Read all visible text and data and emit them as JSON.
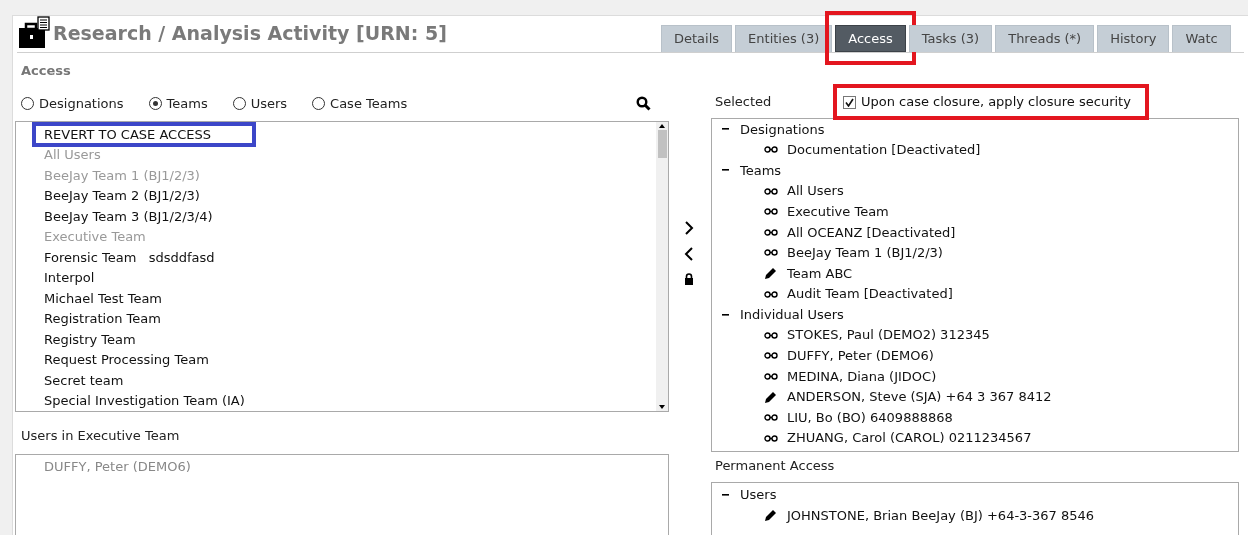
{
  "window": {
    "title": "Research / Analysis Activity [URN: 5]"
  },
  "tabs": [
    {
      "label": "Details",
      "selected": false
    },
    {
      "label": "Entities (3)",
      "selected": false
    },
    {
      "label": "Access",
      "selected": true,
      "color": "#e3161f"
    },
    {
      "label": "Tasks (3)",
      "selected": false
    },
    {
      "label": "Threads (*)",
      "selected": false
    },
    {
      "label": "History",
      "selected": false
    },
    {
      "label": "Watc",
      "selected": false
    }
  ],
  "section_label": "Access",
  "radios": [
    {
      "label": "Designations",
      "selected": false
    },
    {
      "label": "Teams",
      "selected": true
    },
    {
      "label": "Users",
      "selected": false
    },
    {
      "label": "Case Teams",
      "selected": false
    }
  ],
  "team_list": [
    {
      "label": "REVERT TO CASE ACCESS",
      "disabled": false,
      "color": "#3c46c8"
    },
    {
      "label": "All Users",
      "disabled": true
    },
    {
      "label": "BeeJay Team 1 (BJ1/2/3)",
      "disabled": true
    },
    {
      "label": "BeeJay Team 2 (BJ1/2/3)",
      "disabled": false
    },
    {
      "label": "BeeJay Team 3 (BJ1/2/3/4)",
      "disabled": false
    },
    {
      "label": "Executive Team",
      "disabled": true
    },
    {
      "label": "Forensic Team   sdsddfasd",
      "disabled": false
    },
    {
      "label": "Interpol",
      "disabled": false
    },
    {
      "label": "Michael Test Team",
      "disabled": false
    },
    {
      "label": "Registration Team",
      "disabled": false
    },
    {
      "label": "Registry Team",
      "disabled": false
    },
    {
      "label": "Request Processing Team",
      "disabled": false
    },
    {
      "label": "Secret team",
      "disabled": false
    },
    {
      "label": "Special Investigation Team (IA)",
      "disabled": false
    }
  ],
  "users_label": "Users in Executive Team",
  "users_list": [
    "DUFFY, Peter (DEMO6)"
  ],
  "selected_label": "Selected",
  "closure_checkbox": {
    "label": "Upon case closure, apply closure security",
    "checked": true,
    "color": "#e3161f"
  },
  "selected_tree": [
    {
      "label": "Designations",
      "expanded": true,
      "children": [
        {
          "label": "Documentation [Deactivated]",
          "kind": "view"
        }
      ]
    },
    {
      "label": "Teams",
      "expanded": true,
      "children": [
        {
          "label": "All Users",
          "kind": "view"
        },
        {
          "label": "Executive Team",
          "kind": "view"
        },
        {
          "label": "All OCEANZ [Deactivated]",
          "kind": "view"
        },
        {
          "label": "BeeJay Team 1 (BJ1/2/3)",
          "kind": "view"
        },
        {
          "label": "Team ABC",
          "kind": "edit"
        },
        {
          "label": "Audit Team [Deactivated]",
          "kind": "view"
        }
      ]
    },
    {
      "label": "Individual Users",
      "expanded": true,
      "children": [
        {
          "label": "STOKES, Paul (DEMO2) 312345",
          "kind": "view"
        },
        {
          "label": "DUFFY, Peter (DEMO6)",
          "kind": "view"
        },
        {
          "label": "MEDINA, Diana (JIDOC)",
          "kind": "view"
        },
        {
          "label": "ANDERSON, Steve (SJA) +64 3 367 8412",
          "kind": "edit"
        },
        {
          "label": "LIU, Bo (BO) 6409888868",
          "kind": "view"
        },
        {
          "label": "ZHUANG, Carol (CAROL) 0211234567",
          "kind": "view"
        }
      ]
    }
  ],
  "permanent_label": "Permanent Access",
  "permanent_tree": [
    {
      "label": "Users",
      "expanded": true,
      "children": [
        {
          "label": "JOHNSTONE, Brian BeeJay (BJ) +64-3-367 8546",
          "kind": "edit"
        }
      ]
    }
  ]
}
